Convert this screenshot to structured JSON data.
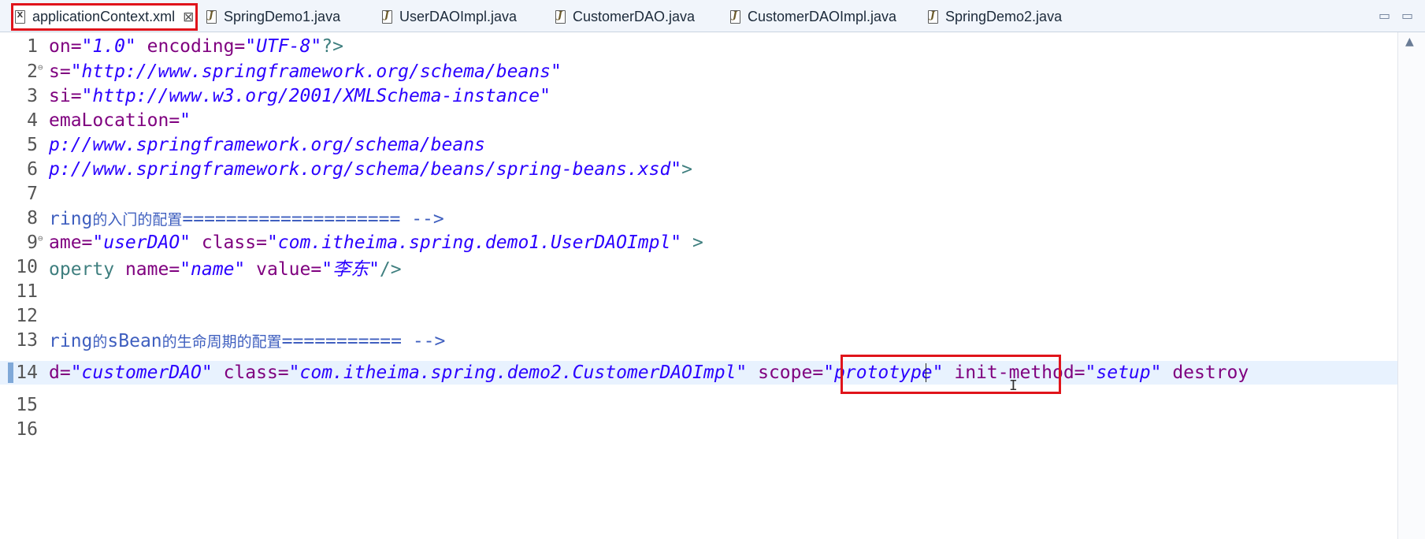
{
  "tabs": [
    {
      "label": "applicationContext.xml",
      "icon": "xml-file-icon",
      "active": true
    },
    {
      "label": "SpringDemo1.java",
      "icon": "java-file-icon"
    },
    {
      "label": "UserDAOImpl.java",
      "icon": "java-file-icon"
    },
    {
      "label": "CustomerDAO.java",
      "icon": "java-file-icon"
    },
    {
      "label": "CustomerDAOImpl.java",
      "icon": "java-file-icon"
    },
    {
      "label": "SpringDemo2.java",
      "icon": "java-file-icon"
    }
  ],
  "window_controls": {
    "minimize": "▭",
    "maximize": "▭"
  },
  "editor": {
    "line_numbers": [
      "1",
      "2",
      "3",
      "4",
      "5",
      "6",
      "7",
      "8",
      "9",
      "10",
      "11",
      "12",
      "13",
      "14",
      "15",
      "16"
    ],
    "lines": {
      "l1": {
        "a": "on=",
        "b": "\"1.0\"",
        "c": " encoding=",
        "d": "\"UTF-8\"",
        "e": "?>"
      },
      "l2": {
        "a": "s=",
        "b": "\"http://www.springframework.org/schema/beans\""
      },
      "l3": {
        "a": "si=",
        "b": "\"http://www.w3.org/2001/XMLSchema-instance\""
      },
      "l4": {
        "a": "emaLocation=",
        "b": "\""
      },
      "l5": {
        "a": "p://www.springframework.org/schema/beans"
      },
      "l6": {
        "a": "p://www.springframework.org/schema/beans/spring-beans.xsd\"",
        "b": ">"
      },
      "l8": {
        "a": "ring",
        "b": "的入门的配置",
        "c": "==================== -->"
      },
      "l9": {
        "a": "ame=",
        "b": "\"userDAO\"",
        "c": " class=",
        "d": "\"com.itheima.spring.demo1.UserDAOImpl\"",
        "e": " >"
      },
      "l10": {
        "a": "operty",
        "b": " name=",
        "c": "\"name\"",
        "d": " value=",
        "e": "\"李东\"",
        "f": "/>"
      },
      "l13": {
        "a": "ring",
        "b": "的",
        "c": "sBean",
        "d": "的生命周期的配置",
        "e": "=========== -->"
      },
      "l14": {
        "a": "d=",
        "b": "\"customerDAO\"",
        "c": " class=",
        "d": "\"com.itheima.spring.demo2.CustomerDAOImpl\"",
        "e": " scope=",
        "f": "\"prototype\"",
        "g": " init-method=",
        "h": "\"setup\"",
        "i": " destroy"
      }
    }
  },
  "colors": {
    "highlight_box": "#e0141b",
    "current_line": "#e8f2fe",
    "xml_attribute": "#7f007f",
    "xml_string": "#2a00ff",
    "xml_comment": "#3f5fbf",
    "xml_tag": "#3f7f7f"
  }
}
